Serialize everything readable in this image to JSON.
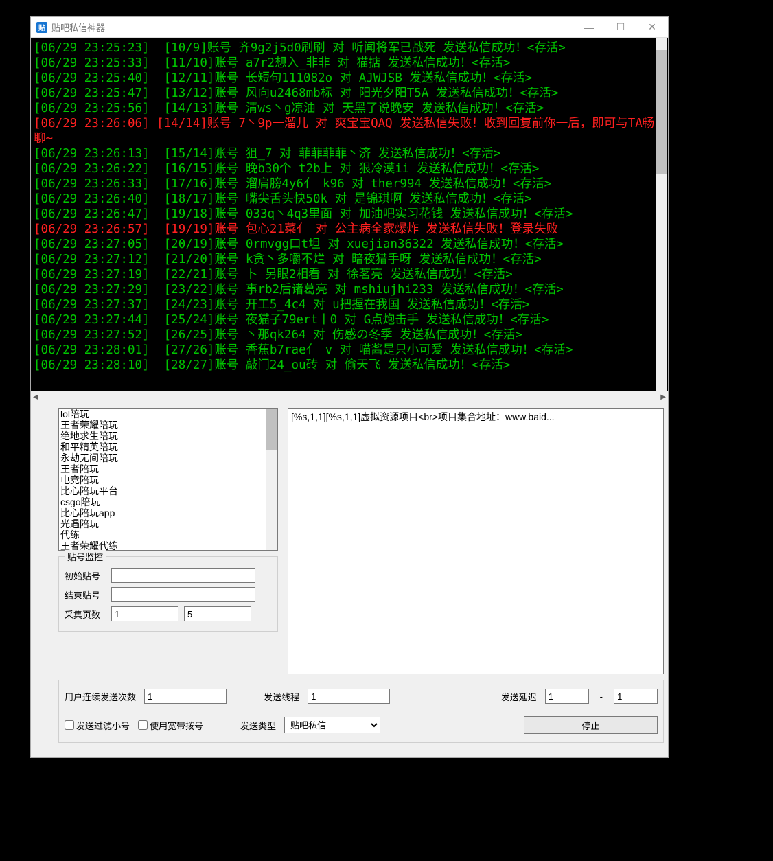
{
  "titlebar": {
    "title": "贴吧私信神器"
  },
  "log_lines": [
    {
      "cls": "log-green",
      "ts": "[06/29 23:25:23]",
      "body": "  [10/9]账号 齐9g2j5d0刷刷 对 听闻将军已战死 发送私信成功！<存活>"
    },
    {
      "cls": "log-green",
      "ts": "[06/29 23:25:33]",
      "body": "  [11/10]账号 a7r2想入_非非 对 猫掂 发送私信成功！<存活>"
    },
    {
      "cls": "log-green",
      "ts": "[06/29 23:25:40]",
      "body": "  [12/11]账号 长短句111082o 对 AJWJSB 发送私信成功！<存活>"
    },
    {
      "cls": "log-green",
      "ts": "[06/29 23:25:47]",
      "body": "  [13/12]账号 风向u2468mb标 对 阳光夕阳T5A 发送私信成功！<存活>"
    },
    {
      "cls": "log-green",
      "ts": "[06/29 23:25:56]",
      "body": "  [14/13]账号 清ws丶g凉油 对 天黑了说晚安 发送私信成功！<存活>"
    },
    {
      "cls": "log-red-wrap",
      "ts": "[06/29 23:26:06]",
      "body": "  [14/14]账号 7丶9p一溜儿 对 爽宝宝QAQ 发送私信失败！收到回复前你一后，即可与TA畅聊~"
    },
    {
      "cls": "log-green",
      "ts": "[06/29 23:26:13]",
      "body": "  [15/14]账号 狙_7 对 菲菲菲菲丶济 发送私信成功！<存活>"
    },
    {
      "cls": "log-green",
      "ts": "[06/29 23:26:22]",
      "body": "  [16/15]账号 晚b30个 t2b上 对 狠冷漠ii 发送私信成功！<存活>"
    },
    {
      "cls": "log-green",
      "ts": "[06/29 23:26:33]",
      "body": "  [17/16]账号 溜肩膀4y6亻 k96 对 ther994 发送私信成功！<存活>"
    },
    {
      "cls": "log-green",
      "ts": "[06/29 23:26:40]",
      "body": "  [18/17]账号 嘴尖舌头快50k 对 是锦琪啊 发送私信成功！<存活>"
    },
    {
      "cls": "log-green",
      "ts": "[06/29 23:26:47]",
      "body": "  [19/18]账号 033q丶4q3里面 对 加油吧实习花钱 发送私信成功！<存活>"
    },
    {
      "cls": "log-red",
      "ts": "[06/29 23:26:57]",
      "body": "  [19/19]账号 包心21菜亻 对 公主病全家爆炸 发送私信失败！登录失败"
    },
    {
      "cls": "log-green",
      "ts": "[06/29 23:27:05]",
      "body": "  [20/19]账号 0rmvgg口t坦 对 xuejian36322 发送私信成功！<存活>"
    },
    {
      "cls": "log-green",
      "ts": "[06/29 23:27:12]",
      "body": "  [21/20]账号 k贪丶多嚼不烂 对 暗夜猎手呀 发送私信成功！<存活>"
    },
    {
      "cls": "log-green",
      "ts": "[06/29 23:27:19]",
      "body": "  [22/21]账号 卜 另眼2相看 对 徐茗亮 发送私信成功！<存活>"
    },
    {
      "cls": "log-green",
      "ts": "[06/29 23:27:29]",
      "body": "  [23/22]账号 事rb2后诸葛亮 对 mshiujhi233 发送私信成功！<存活>"
    },
    {
      "cls": "log-green",
      "ts": "[06/29 23:27:37]",
      "body": "  [24/23]账号 开工5_4c4 对 u把握在我国 发送私信成功！<存活>"
    },
    {
      "cls": "log-green",
      "ts": "[06/29 23:27:44]",
      "body": "  [25/24]账号 夜猫子79ert丨0 对 G点炮击手 发送私信成功！<存活>"
    },
    {
      "cls": "log-green",
      "ts": "[06/29 23:27:52]",
      "body": "  [26/25]账号 丶那qk264 对 伤感の冬季 发送私信成功！<存活>"
    },
    {
      "cls": "log-green",
      "ts": "[06/29 23:28:01]",
      "body": "  [27/26]账号 香蕉b7rae亻 v 对 喵酱是只小可爱 发送私信成功！<存活>"
    },
    {
      "cls": "log-green",
      "ts": "[06/29 23:28:10]",
      "body": "  [28/27]账号 敲门24_ou砖 对 偷天飞 发送私信成功！<存活>"
    }
  ],
  "keyword_list": [
    "lol陪玩",
    "王者荣耀陪玩",
    "绝地求生陪玩",
    "和平精英陪玩",
    "永劫无间陪玩",
    "王者陪玩",
    "电竞陪玩",
    "比心陪玩平台",
    "csgo陪玩",
    "比心陪玩app",
    "光遇陪玩",
    "代练",
    "王者荣耀代练"
  ],
  "message_template": "[%s,1,1][%s,1,1]虚拟资源项目<br>项目集合地址：www.baid...",
  "monitor": {
    "legend": "贴号监控",
    "start_label": "初始贴号",
    "end_label": "结束贴号",
    "page_label": "采集页数",
    "start_value": "",
    "end_value": "",
    "page_from": "1",
    "page_to": "5"
  },
  "bottom": {
    "send_count_label": "用户连续发送次数",
    "send_count_value": "1",
    "thread_label": "发送线程",
    "thread_value": "1",
    "delay_label": "发送延迟",
    "delay_from": "1",
    "delay_to": "1",
    "filter_small_label": "发送过滤小号",
    "use_broadband_label": "使用宽带拨号",
    "send_type_label": "发送类型",
    "send_type_value": "贴吧私信",
    "stop_label": "停止"
  }
}
